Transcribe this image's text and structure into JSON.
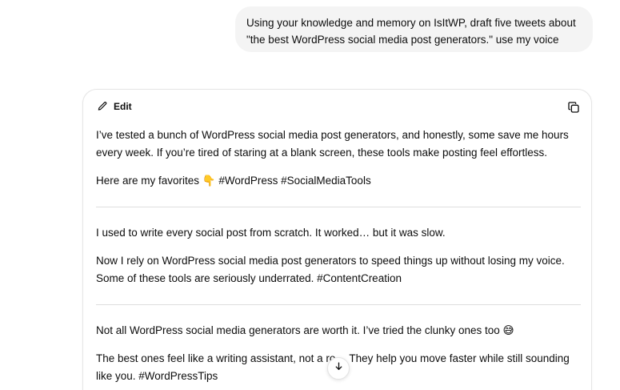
{
  "user_message": {
    "line1": "Using your knowledge and memory on IsItWP, draft five tweets about",
    "line2": "\"the best WordPress social media post generators.\" use my voice"
  },
  "canvas": {
    "edit_label": "Edit",
    "icons": {
      "edit": "pencil-icon",
      "copy": "copy-icon",
      "scroll": "arrow-down-icon"
    },
    "tweets": [
      {
        "paragraphs": [
          "I’ve tested a bunch of WordPress social media post generators, and honestly, some save me hours every week. If you’re tired of staring at a blank screen, these tools make posting feel effortless.",
          "Here are my favorites 👇 #WordPress #SocialMediaTools"
        ]
      },
      {
        "paragraphs": [
          "I used to write every social post from scratch. It worked… but it was slow.",
          "Now I rely on WordPress social media post generators to speed things up without losing my voice. Some of these tools are seriously underrated. #ContentCreation"
        ]
      },
      {
        "paragraphs": [
          "Not all WordPress social media generators are worth it. I’ve tried the clunky ones too 😅",
          "The best ones feel like a writing assistant, not a ro… They help you move faster while still sounding like you. #WordPressTips"
        ]
      }
    ]
  }
}
